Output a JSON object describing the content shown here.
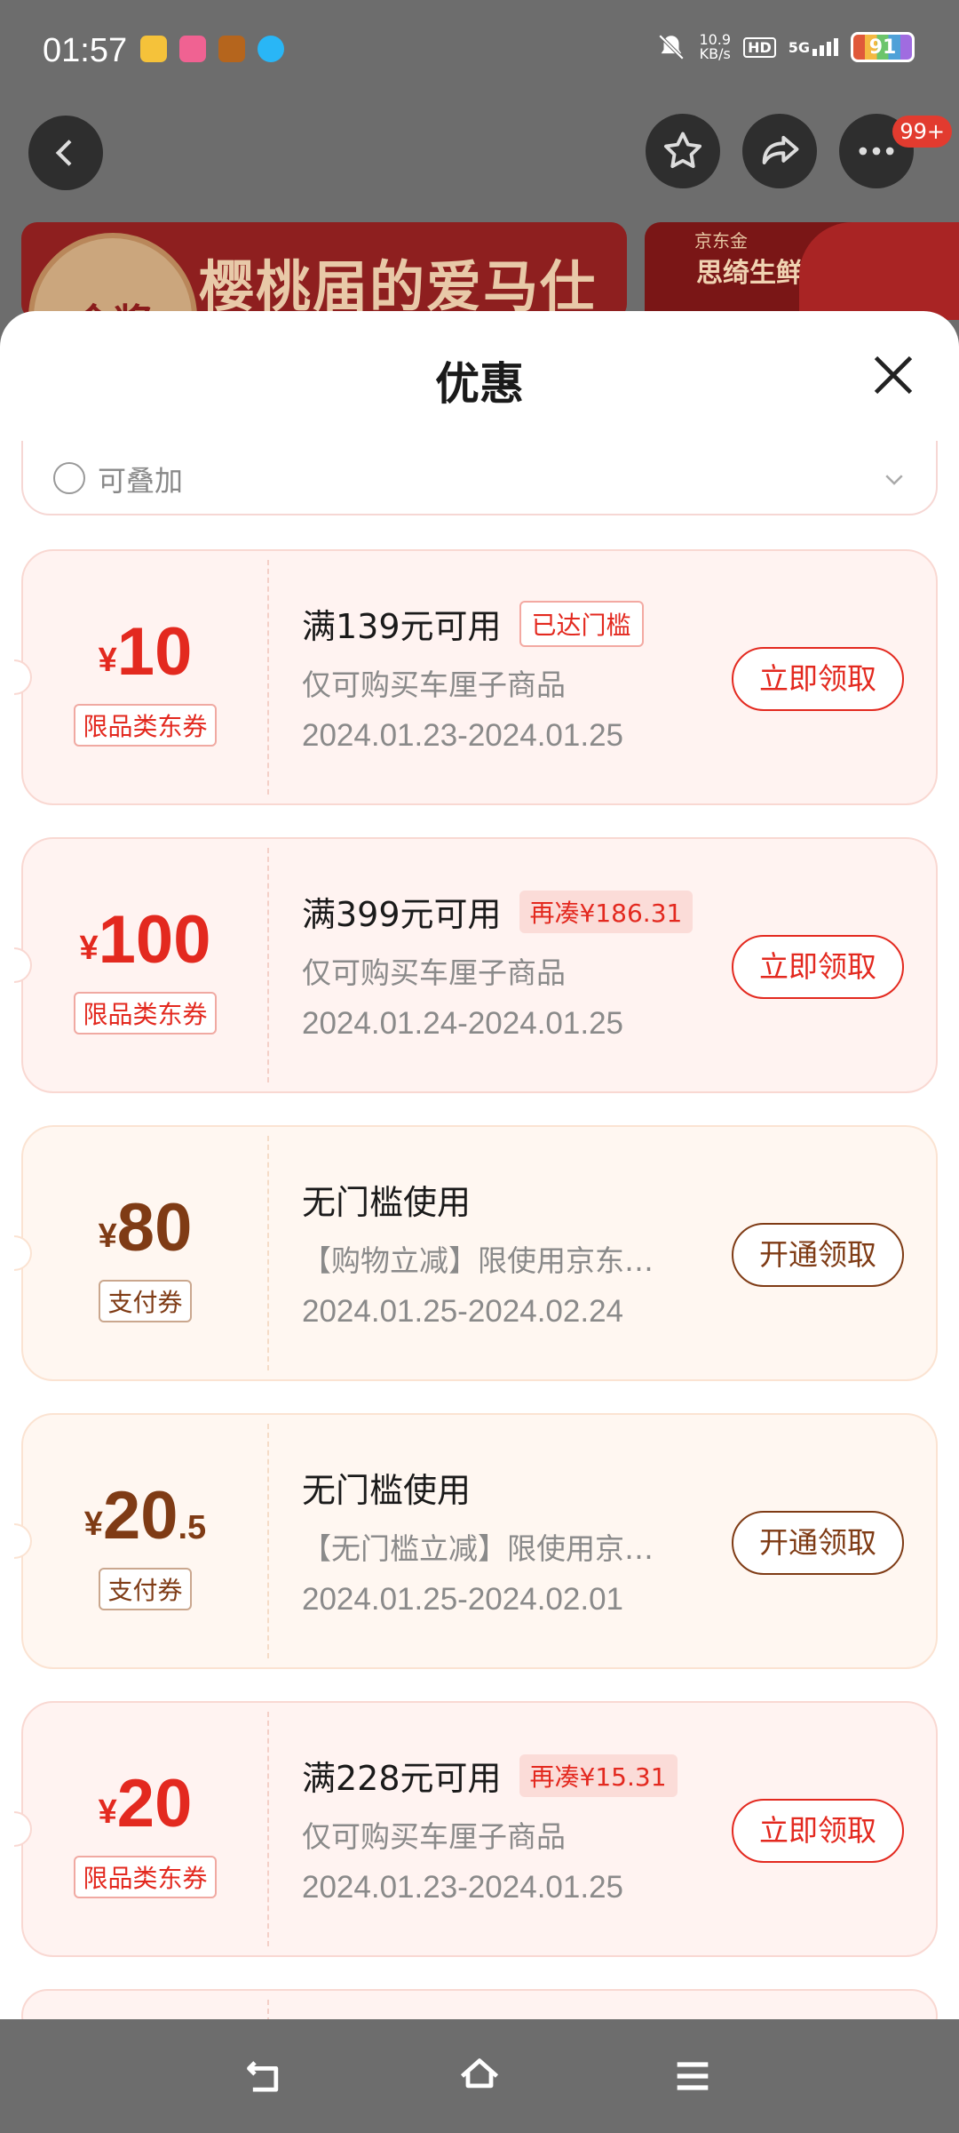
{
  "status_bar": {
    "time": "01:57",
    "net_speed_value": "10.9",
    "net_speed_unit": "KB/s",
    "hd": "HD",
    "network": "5G",
    "battery": "91"
  },
  "header": {
    "notification_badge": "99+"
  },
  "banners": {
    "banner1_seal": "金奖",
    "banner1_text": "樱桃届的爱马仕",
    "banner2_brand": "京东金",
    "banner2_text": "思绮生鲜"
  },
  "sheet": {
    "title": "优惠",
    "stack_label": "可叠加"
  },
  "coupons": [
    {
      "yen": "¥",
      "amount": "10",
      "decimal": "",
      "tag": "限品类东券",
      "condition": "满139元可用",
      "chip": "已达门槛",
      "scope": "仅可购买车厘子商品",
      "date": "2024.01.23-2024.01.25",
      "button": "立即领取"
    },
    {
      "yen": "¥",
      "amount": "100",
      "decimal": "",
      "tag": "限品类东券",
      "condition": "满399元可用",
      "chip": "再凑¥186.31",
      "scope": "仅可购买车厘子商品",
      "date": "2024.01.24-2024.01.25",
      "button": "立即领取"
    },
    {
      "yen": "¥",
      "amount": "80",
      "decimal": "",
      "tag": "支付券",
      "condition": "无门槛使用",
      "chip": "",
      "scope": "【购物立减】限使用京东…",
      "date": "2024.01.25-2024.02.24",
      "button": "开通领取"
    },
    {
      "yen": "¥",
      "amount": "20",
      "decimal": ".5",
      "tag": "支付券",
      "condition": "无门槛使用",
      "chip": "",
      "scope": "【无门槛立减】限使用京…",
      "date": "2024.01.25-2024.02.01",
      "button": "开通领取"
    },
    {
      "yen": "¥",
      "amount": "20",
      "decimal": "",
      "tag": "限品类东券",
      "condition": "满228元可用",
      "chip": "再凑¥15.31",
      "scope": "仅可购买车厘子商品",
      "date": "2024.01.23-2024.01.25",
      "button": "立即领取"
    }
  ]
}
